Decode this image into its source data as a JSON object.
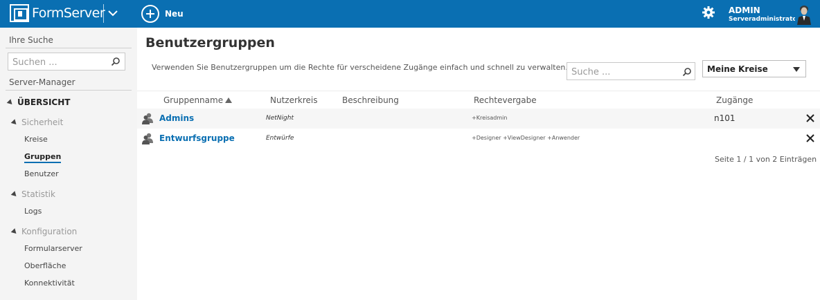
{
  "app": {
    "logo_text": "FormServer",
    "new_label": "Neu",
    "user_name": "ADMIN",
    "user_role": "Serveradministrator"
  },
  "icons": {
    "logo": "formserver-logo-icon",
    "chevron": "chevron-down-icon",
    "new": "plus-circle-icon",
    "settings": "gear-icon",
    "avatar": "user-avatar-icon",
    "search": "search-icon",
    "group": "group-icon",
    "delete": "close-icon"
  },
  "colors": {
    "brand": "#0a6fb2",
    "sidebar_bg": "#f4f4f4",
    "link": "#0a6fb2"
  },
  "sidebar": {
    "search_heading": "Ihre Suche",
    "search_placeholder": "Suchen ...",
    "manager_heading": "Server-Manager",
    "overview_label": "ÜBERSICHT",
    "sections": [
      {
        "label": "Sicherheit",
        "items": [
          "Kreise",
          "Gruppen",
          "Benutzer"
        ]
      },
      {
        "label": "Statistik",
        "items": [
          "Logs"
        ]
      },
      {
        "label": "Konfiguration",
        "items": [
          "Formularserver",
          "Oberfläche",
          "Konnektivität"
        ]
      }
    ],
    "active_item": "Gruppen"
  },
  "main": {
    "title": "Benutzergruppen",
    "description": "Verwenden Sie Benutzergruppen um die Rechte für verscheidene Zugänge einfach und schnell zu verwalten.",
    "search_placeholder": "Suche ...",
    "filter_selected": "Meine Kreise"
  },
  "table": {
    "columns": [
      "Gruppenname",
      "Nutzerkreis",
      "Beschreibung",
      "Rechtevergabe",
      "Zugänge"
    ],
    "sort_column": "Gruppenname",
    "sort_direction": "ascending",
    "rows": [
      {
        "name": "Admins",
        "circle": "NetNight",
        "description": "",
        "rights": "+Kreisadmin",
        "access": "n101"
      },
      {
        "name": "Entwurfsgruppe",
        "circle": "Entwürfe",
        "description": "",
        "rights": "+Designer +ViewDesigner +Anwender",
        "access": ""
      }
    ],
    "pager": "Seite 1 / 1 von 2 Einträgen"
  }
}
